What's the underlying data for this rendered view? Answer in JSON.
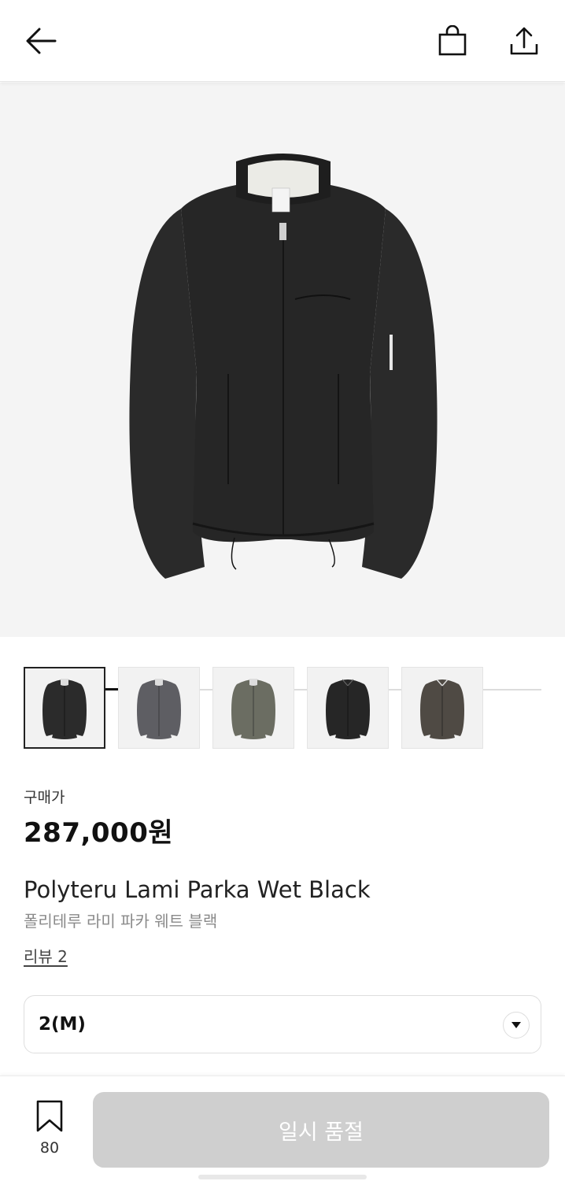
{
  "header": {
    "back_icon": "arrow-left-icon",
    "bag_icon": "shopping-bag-icon",
    "share_icon": "share-upload-icon"
  },
  "gallery": {
    "progress": 0.333,
    "thumbnails": [
      {
        "color": "#2b2b2b",
        "selected": true
      },
      {
        "color": "#5e5e63",
        "selected": false
      },
      {
        "color": "#6b6d62",
        "selected": false
      },
      {
        "color": "#262626",
        "selected": false
      },
      {
        "color": "#4f4a44",
        "selected": false
      }
    ]
  },
  "product": {
    "price_label": "구매가",
    "price": "287,000원",
    "name_en": "Polyteru Lami Parka Wet Black",
    "name_ko": "폴리테루 라미 파카 웨트 블랙",
    "review_link": "리뷰 2"
  },
  "options": {
    "size_selected": "2(M)",
    "dropdown_icon": "caret-down-icon"
  },
  "footer": {
    "wishlist_icon": "bookmark-icon",
    "wishlist_count": "80",
    "buy_button_label": "일시 품절"
  }
}
